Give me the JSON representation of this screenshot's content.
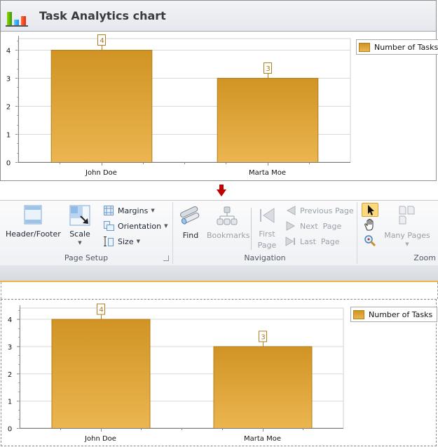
{
  "window": {
    "title": "Task Analytics chart",
    "logo_icon": "bar-chart-icon"
  },
  "chart_data": [
    {
      "type": "bar",
      "title": "",
      "xlabel": "",
      "ylabel": "",
      "categories": [
        "John Doe",
        "Marta Moe"
      ],
      "series": [
        {
          "name": "Number of Tasks",
          "values": [
            4,
            3
          ]
        }
      ],
      "ylim": [
        0,
        4.4
      ],
      "yticks": [
        "0",
        "1",
        "2",
        "3",
        "4"
      ],
      "value_labels": [
        "4",
        "3"
      ],
      "grid": true,
      "legend": "top-right",
      "bar_color_top": "#d19424",
      "bar_color_bottom": "#ebb550",
      "bar_border": "#b07f1e"
    },
    {
      "type": "bar",
      "title": "",
      "xlabel": "",
      "ylabel": "",
      "categories": [
        "John Doe",
        "Marta Moe"
      ],
      "series": [
        {
          "name": "Number of Tasks",
          "values": [
            4,
            3
          ]
        }
      ],
      "ylim": [
        0,
        4.4
      ],
      "yticks": [
        "0",
        "1",
        "2",
        "3",
        "4"
      ],
      "value_labels": [
        "4",
        "3"
      ],
      "grid": true,
      "legend": "top-right",
      "bar_color_top": "#d19424",
      "bar_color_bottom": "#ebb550",
      "bar_border": "#b07f1e"
    }
  ],
  "indicator": {
    "icon": "arrow-down-icon",
    "color": "#c00000"
  },
  "ribbon": {
    "page_setup": {
      "label": "Page Setup",
      "header_footer": "Header/Footer",
      "scale": "Scale",
      "margins": "Margins",
      "orientation": "Orientation",
      "size": "Size"
    },
    "navigation": {
      "label": "Navigation",
      "find": "Find",
      "bookmarks": "Bookmarks",
      "first_page_1": "First",
      "first_page_2": "Page",
      "previous_page": "Previous Page",
      "next_page": "Next  Page",
      "last_page": "Last  Page"
    },
    "zoom": {
      "label": "Zoom",
      "many_pages": "Many Pages"
    }
  },
  "colors": {
    "accent_strip": "#f0b541",
    "selected_tool_bg": "#fbd97c"
  }
}
